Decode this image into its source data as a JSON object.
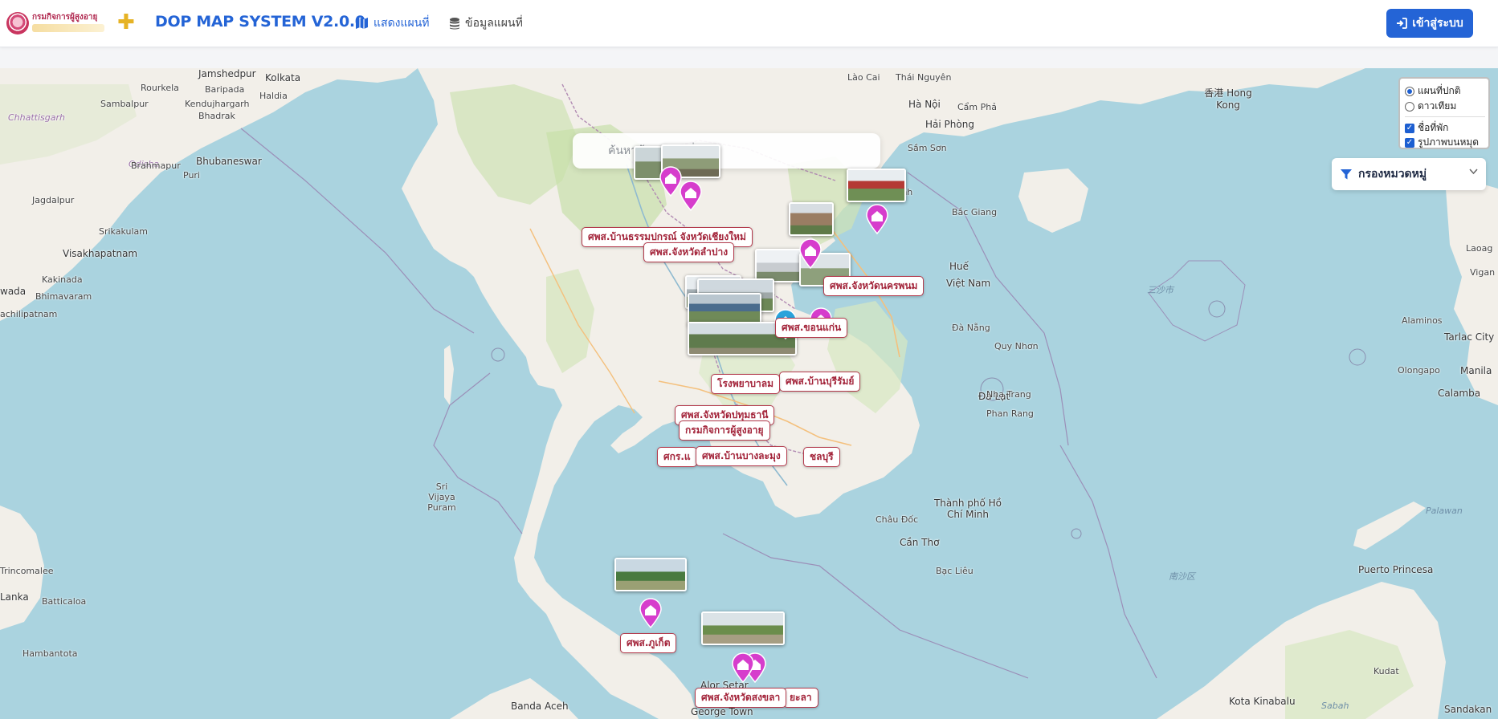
{
  "navbar": {
    "logo_text": "กรมกิจการผู้สูงอายุ",
    "brand": "DOP MAP SYSTEM V2.0.0",
    "nav_map": "แสดงแผนที่",
    "nav_data": "ข้อมูลแผนที่",
    "login": "เข้าสู่ระบบ"
  },
  "search": {
    "placeholder": "ค้นหาข้อมูลแผนที่"
  },
  "layers": {
    "base_normal": "แผนที่ปกติ",
    "base_satellite": "ดาวเทียม",
    "show_names": "ชื่อที่พัก",
    "show_images": "รูปภาพบนหมุด"
  },
  "filter": {
    "label": "กรองหมวดหมู่"
  },
  "colors": {
    "accent": "#2464d6",
    "pin": "#d63dcc",
    "pin_alt": "#29a3db",
    "label_border": "#b43b4d"
  },
  "labels": [
    "ศพส.บ้านธรรมปกรณ์ จังหวัดเชียงใหม่",
    "ศพส.จังหวัดลำปาง",
    "ศพส.จังหวัดนครพนม",
    "ศพส.ขอนแก่น",
    "ศพส.บ้านบุรีรัมย์",
    "โรงพยาบาลม",
    "ศพส.จังหวัดปทุมธานี",
    "กรมกิจการผู้สูงอายุ",
    "ศกร.แ",
    "ศพส.บ้านบางละมุง",
    "ชลบุรี",
    "ศพส.ภูเก็ต",
    "ศพส.จังหวัดสงขลา",
    "ยะลา"
  ],
  "places": {
    "jamshedpur": "Jamshedpur",
    "kolkata": "Kolkata",
    "rourkela": "Rourkela",
    "baripada": "Baripada",
    "haldia": "Haldia",
    "sambalpur": "Sambalpur",
    "kendujhargarh": "Kendujhargarh",
    "bhadrak": "Bhadrak",
    "chhattisgarh": "Chhattisgarh",
    "odisha": "Odisha",
    "bhubaneswar": "Bhubaneswar",
    "brahmapur": "Brahmapur",
    "puri": "Puri",
    "jagdalpur": "Jagdalpur",
    "srikakulam": "Srikakulam",
    "visakhapatnam": "Visakhapatnam",
    "kakinada": "Kakinada",
    "bhimavaram": "Bhimavaram",
    "vada": "wada",
    "machilipatnam": "achilipatnam",
    "trincomalee": "Trincomalee",
    "lanka": "Lanka",
    "batticaloa": "Batticaloa",
    "hambantota": "Hambantota",
    "sri_vijaya": "Sri Vijaya Puram",
    "banda_aceh": "Banda Aceh",
    "george_town": "George Town",
    "alor_setar": "Alor Setar",
    "hanoi": "Hà Nội",
    "haiphong": "Hải Phòng",
    "hue": "Huế",
    "vietnam": "Việt Nam",
    "danang": "Đà Nẵng",
    "quy_nhon": "Quy Nhơn",
    "dalat": "Đà Lạt",
    "nha_trang": "Nha Trang",
    "phan_rang": "Phan Rang",
    "hcmc": "Thành phố Hồ Chí Minh",
    "can_tho": "Cần Thơ",
    "bac_lieu": "Bạc Liêu",
    "hong_kong": "香港 Hong Kong",
    "kota_kinabalu": "Kota Kinabalu",
    "sandakan": "Sandakan",
    "kudat": "Kudat",
    "puerto_princesa": "Puerto Princesa",
    "tarlac": "Tarlac City",
    "manila": "Manila",
    "calamba": "Calamba",
    "olongapo": "Olongapo",
    "alaminos": "Alaminos",
    "laoag": "Laoag",
    "vigan": "Vigan",
    "bac_giang": "Bắc Giang",
    "thai_nguyen": "Thái Nguyên",
    "lao_cai": "Lào Cai",
    "cam_pha": "Cẩm Phả",
    "sam_son": "Sầm Sơn",
    "vinh": "Vinh",
    "chau_doc": "Châu Đốc",
    "sea_palawan": "Palawan",
    "sea_sabah": "Sabah",
    "sea_nansha": "南沙区",
    "sea_sansha": "三沙市"
  }
}
